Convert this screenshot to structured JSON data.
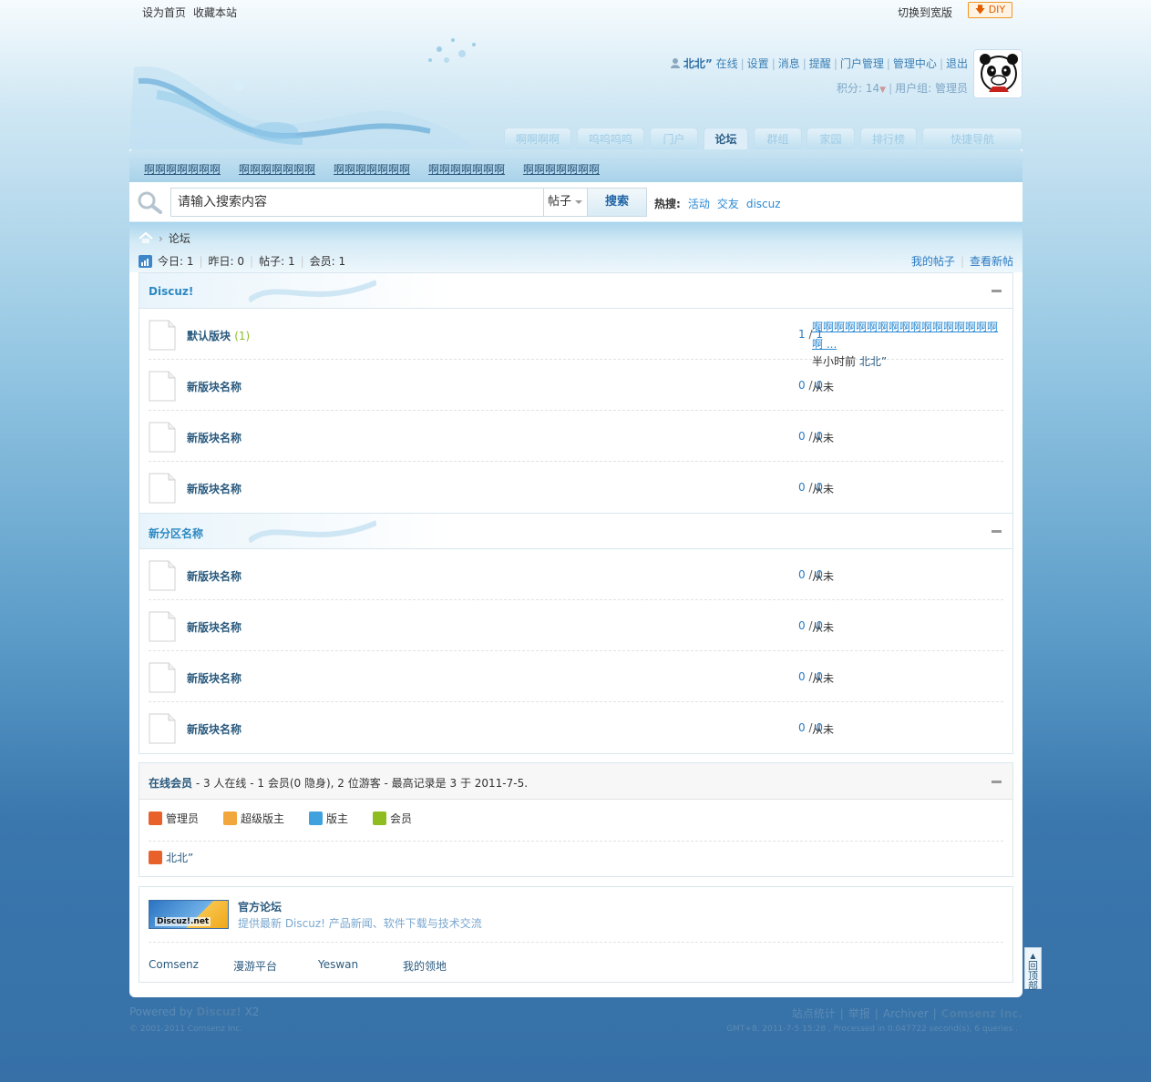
{
  "topbar": {
    "set_home": "设为首页",
    "bookmark": "收藏本站",
    "switch_wide": "切换到宽版",
    "diy": "DIY"
  },
  "user": {
    "name": "北北”",
    "status": "在线",
    "links": [
      "设置",
      "消息",
      "提醒",
      "门户管理",
      "管理中心",
      "退出"
    ],
    "credits_label": "积分: 14",
    "group_label": "用户组: 管理员"
  },
  "nav": {
    "tabs": [
      "啊啊啊啊",
      "呜呜呜呜",
      "门户",
      "论坛",
      "群组",
      "家园",
      "排行榜",
      "快捷导航"
    ],
    "active": "论坛"
  },
  "subnav": {
    "items": [
      "啊啊啊啊啊啊啊",
      "啊啊啊啊啊啊啊",
      "啊啊啊啊啊啊啊",
      "啊啊啊啊啊啊啊",
      "啊啊啊啊啊啊啊"
    ]
  },
  "search": {
    "placeholder": "请输入搜索内容",
    "type": "帖子",
    "button": "搜索",
    "hot_label": "热搜:",
    "hot": [
      "活动",
      "交友",
      "discuz"
    ]
  },
  "breadcrumb": {
    "current": "论坛"
  },
  "stats": {
    "today": "今日: 1",
    "yesterday": "昨日: 0",
    "posts": "帖子: 1",
    "members": "会员: 1",
    "my_posts": "我的帖子",
    "new_posts": "查看新帖"
  },
  "categories": [
    {
      "title": "Discuz!",
      "forums": [
        {
          "name": "默认版块",
          "today": "(1)",
          "threads": "1",
          "posts": "1",
          "last_title": "啊啊啊啊啊啊啊啊啊啊啊啊啊啊啊啊啊啊 ...",
          "last_time": "半小时前",
          "last_user": "北北”"
        },
        {
          "name": "新版块名称",
          "threads": "0",
          "posts": "0",
          "last": "从未"
        },
        {
          "name": "新版块名称",
          "threads": "0",
          "posts": "0",
          "last": "从未"
        },
        {
          "name": "新版块名称",
          "threads": "0",
          "posts": "0",
          "last": "从未"
        }
      ]
    },
    {
      "title": "新分区名称",
      "forums": [
        {
          "name": "新版块名称",
          "threads": "0",
          "posts": "0",
          "last": "从未"
        },
        {
          "name": "新版块名称",
          "threads": "0",
          "posts": "0",
          "last": "从未"
        },
        {
          "name": "新版块名称",
          "threads": "0",
          "posts": "0",
          "last": "从未"
        },
        {
          "name": "新版块名称",
          "threads": "0",
          "posts": "0",
          "last": "从未"
        }
      ]
    }
  ],
  "online": {
    "label": "在线会员",
    "summary": " - 3 人在线 - 1 会员(0 隐身), 2 位游客 - 最高记录是 3 于 2011-7-5.",
    "legend": [
      {
        "label": "管理员",
        "color": "#e8602a"
      },
      {
        "label": "超级版主",
        "color": "#f2a73c"
      },
      {
        "label": "版主",
        "color": "#3fa2de"
      },
      {
        "label": "会员",
        "color": "#8fbd1f"
      }
    ],
    "users": [
      "北北”"
    ]
  },
  "friendlinks": {
    "logo_text": "Discuz!.net",
    "title": "官方论坛",
    "desc": "提供最新 Discuz! 产品新闻、软件下载与技术交流",
    "links": [
      "Comsenz",
      "漫游平台",
      "Yeswan",
      "我的领地"
    ]
  },
  "backtop": [
    "回",
    "顶",
    "部"
  ],
  "footer": {
    "powered": "Powered by",
    "product": "Discuz!",
    "version": "X2",
    "copyright": "© 2001-2011 Comsenz Inc.",
    "links": [
      "站点统计",
      "举报",
      "Archiver"
    ],
    "company": "Comsenz Inc.",
    "debug": "GMT+8, 2011-7-5 15:28 , Processed in 0.047722 second(s), 6 queries ."
  }
}
